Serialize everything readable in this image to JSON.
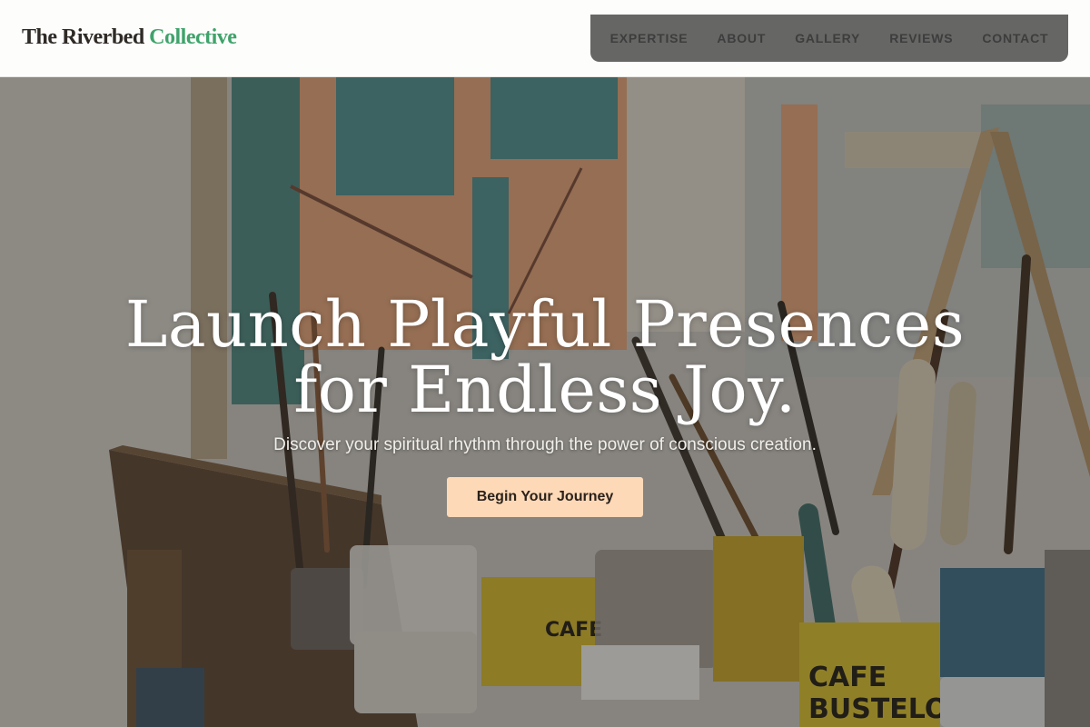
{
  "header": {
    "logo": {
      "part1": "The Riverbed",
      "part2": "Collective"
    },
    "nav": [
      {
        "label": "EXPERTISE"
      },
      {
        "label": "ABOUT"
      },
      {
        "label": "GALLERY"
      },
      {
        "label": "REVIEWS"
      },
      {
        "label": "CONTACT"
      }
    ]
  },
  "hero": {
    "title_line1": "Launch Playful Presences",
    "title_line2": "for Endless Joy.",
    "subtitle": "Discover your spiritual rhythm through the power of conscious creation.",
    "cta_label": "Begin Your Journey",
    "background_image": "art-studio-brushes-and-paint-cans",
    "can_label_1": "CAFE",
    "can_label_2": "BUSTELO"
  },
  "colors": {
    "logo_accent": "#3fa36b",
    "nav_background": "#666665",
    "cta_background": "#fed9b8",
    "header_background": "#fdfdfb"
  }
}
